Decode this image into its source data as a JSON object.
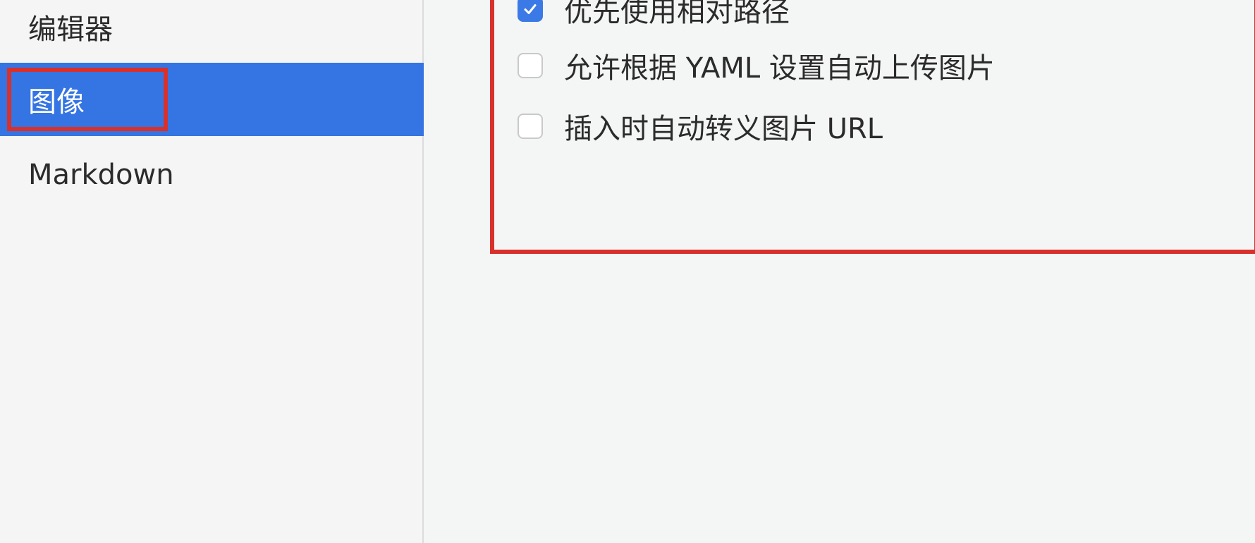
{
  "sidebar": {
    "items": [
      {
        "label": "编辑器",
        "selected": false
      },
      {
        "label": "图像",
        "selected": true
      },
      {
        "label": "Markdown",
        "selected": false
      }
    ]
  },
  "image_settings": {
    "options": [
      {
        "label": "优先使用相对路径",
        "checked": true
      },
      {
        "label": "允许根据 YAML 设置自动上传图片",
        "checked": false
      },
      {
        "label": "插入时自动转义图片 URL",
        "checked": false
      }
    ]
  },
  "colors": {
    "selected_background": "#3574e3",
    "checkbox_checked": "#3b7ae6",
    "annotation_red": "#d8312c"
  },
  "icons": {
    "checked": "checkmark-icon"
  }
}
